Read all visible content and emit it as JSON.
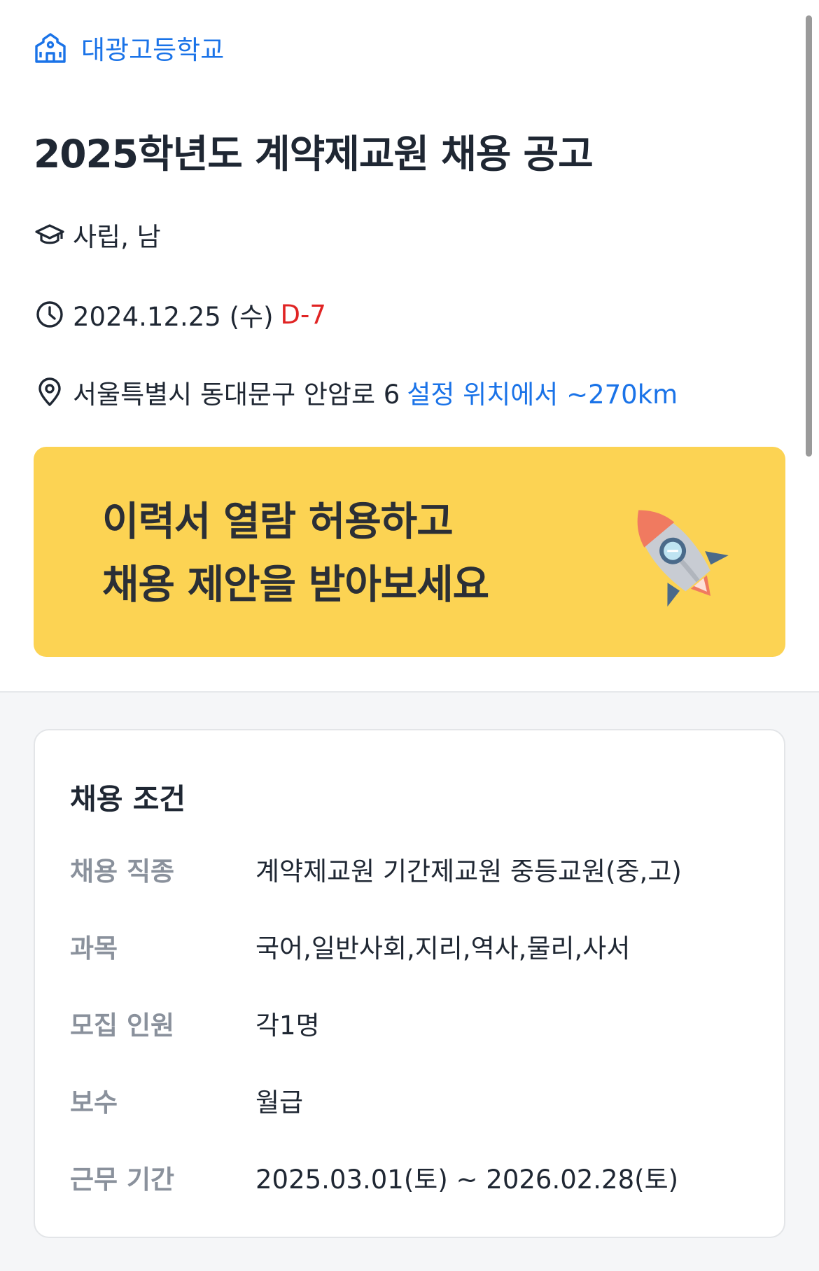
{
  "header": {
    "school_name": "대광고등학교"
  },
  "posting": {
    "title": "2025학년도 계약제교원 채용 공고",
    "school_type": "사립, 남",
    "deadline": "2024.12.25 (수)",
    "dday": "D-7",
    "address": "서울특별시 동대문구 안암로 6",
    "distance": "설정 위치에서 ~270km"
  },
  "banner": {
    "line1": "이력서 열람 허용하고",
    "line2": "채용 제안을 받아보세요",
    "background": "#fcd353"
  },
  "conditions": {
    "title": "채용 조건",
    "rows": [
      {
        "label": "채용 직종",
        "value": "계약제교원 기간제교원  중등교원(중,고)"
      },
      {
        "label": "과목",
        "value": "국어,일반사회,지리,역사,물리,사서"
      },
      {
        "label": "모집 인원",
        "value": "각1명"
      },
      {
        "label": "보수",
        "value": "월급"
      },
      {
        "label": "근무 기간",
        "value": "2025.03.01(토) ~ 2026.02.28(토)"
      }
    ]
  },
  "colors": {
    "accent": "#1a73e8",
    "dday": "#e02424",
    "label_gray": "#8a919c"
  },
  "icons": {
    "school": "school-building-icon",
    "type": "graduation-cap-icon",
    "date": "clock-icon",
    "location": "map-pin-icon",
    "banner": "rocket-icon"
  }
}
